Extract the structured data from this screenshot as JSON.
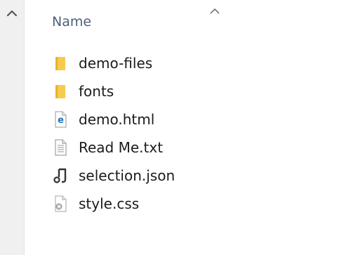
{
  "header": {
    "name_column": "Name"
  },
  "files": [
    {
      "name": "demo-files",
      "icon": "folder-icon"
    },
    {
      "name": "fonts",
      "icon": "folder-icon"
    },
    {
      "name": "demo.html",
      "icon": "edge-html-icon"
    },
    {
      "name": "Read Me.txt",
      "icon": "text-file-icon"
    },
    {
      "name": "selection.json",
      "icon": "json-file-icon"
    },
    {
      "name": "style.css",
      "icon": "css-file-icon"
    }
  ],
  "colors": {
    "header_text": "#4c607a",
    "folder": "#f5c33b",
    "edge_blue": "#1e73be",
    "text": "#1b1b1b"
  }
}
